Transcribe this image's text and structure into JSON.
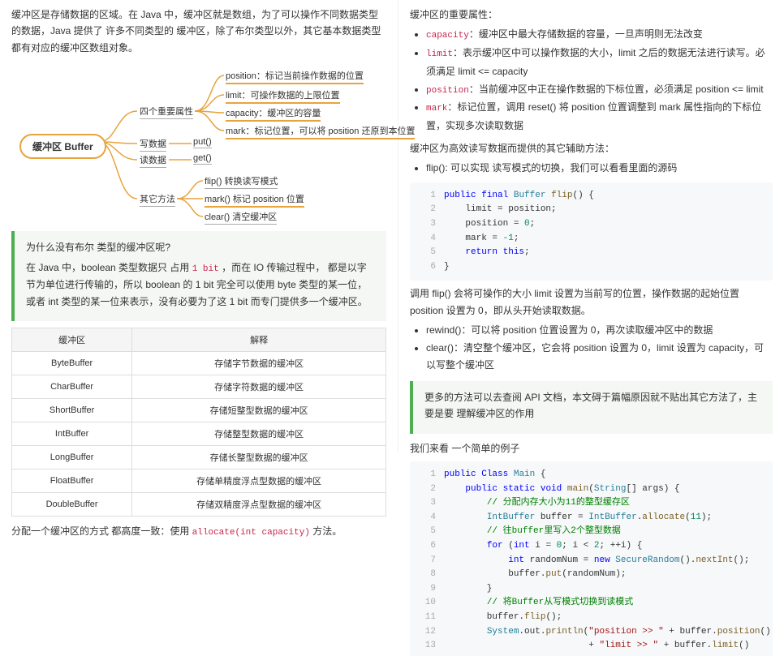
{
  "left": {
    "intro": "缓冲区是存储数据的区域。在 Java 中，缓冲区就是数组，为了可以操作不同数据类型的数据，Java 提供了 许多不同类型的 缓冲区，除了布尔类型以外，其它基本数据类型都有对应的缓冲区数组对象。",
    "mindmap": {
      "root": "缓冲区 Buffer",
      "branch1": "四个重要属性",
      "branch1_leaves": {
        "l1": "position：标记当前操作数据的位置",
        "l2": "limit：可操作数据的上限位置",
        "l3": "capacity：缓冲区的容量",
        "l4": "mark：标记位置，可以将 position 还原到本位置"
      },
      "branch2": "写数据",
      "branch2_leaf": "put()",
      "branch3": "读数据",
      "branch3_leaf": "get()",
      "branch4": "其它方法",
      "branch4_leaves": {
        "l1": "flip() 转换读写模式",
        "l2": "mark() 标记 position 位置",
        "l3": "clear() 清空缓冲区"
      }
    },
    "callout": {
      "q": "为什么没有布尔 类型的缓冲区呢?",
      "a": "在 Java 中，boolean 类型数据只 占用 1 bit ，而在 IO 传输过程中， 都是以字节为单位进行传输的，所以 boolean 的 1 bit 完全可以使用 byte 类型的某一位，或者 int 类型的某一位来表示，没有必要为了这 1 bit 而专门提供多一个缓冲区。"
    },
    "table": {
      "headers": {
        "c1": "缓冲区",
        "c2": "解释"
      },
      "rows": [
        {
          "c1": "ByteBuffer",
          "c2": "存储字节数据的缓冲区"
        },
        {
          "c1": "CharBuffer",
          "c2": "存储字符数据的缓冲区"
        },
        {
          "c1": "ShortBuffer",
          "c2": "存储短整型数据的缓冲区"
        },
        {
          "c1": "IntBuffer",
          "c2": "存储整型数据的缓冲区"
        },
        {
          "c1": "LongBuffer",
          "c2": "存储长整型数据的缓冲区"
        },
        {
          "c1": "FloatBuffer",
          "c2": "存储单精度浮点型数据的缓冲区"
        },
        {
          "c1": "DoubleBuffer",
          "c2": "存储双精度浮点型数据的缓冲区"
        }
      ]
    },
    "bottom1": "分配一个缓冲区的方式 都高度一致：使用 ",
    "bottom_code": "allocate(int capacity)",
    "bottom2": " 方法。"
  },
  "right": {
    "p1": "缓冲区的重要属性：",
    "attrs": {
      "capacity": "：缓冲区中最大存储数据的容量，一旦声明则无法改变",
      "limit": "：表示缓冲区中可以操作数据的大小，limit 之后的数据无法进行读写。必须满足 limit <= capacity",
      "position": "：当前缓冲区中正在操作数据的下标位置，必须满足 position <= limit",
      "mark": "：标记位置，调用 reset() 将 position 位置调整到 mark 属性指向的下标位置，实现多次读取数据"
    },
    "p2": "缓冲区为高效读写数据而提供的其它辅助方法：",
    "helper1": "flip(): 可以实现 读写模式的切换，我们可以看看里面的源码",
    "code1": {
      "l1": "public final Buffer flip() {",
      "l2": "    limit = position;",
      "l3": "    position = 0;",
      "l4": "    mark = -1;",
      "l5": "    return this;",
      "l6": "}"
    },
    "p3": "调用 flip() 会将可操作的大小 limit 设置为当前写的位置，操作数据的起始位置 position 设置为 0，即从头开始读取数据。",
    "helper2": "rewind()：可以将 position 位置设置为 0，再次读取缓冲区中的数据",
    "helper3": "clear()：清空整个缓冲区，它会将 position 设置为 0，limit 设置为 capacity，可以写整个缓冲区",
    "callout2": "更多的方法可以去查阅 API 文档，本文碍于篇幅原因就不贴出其它方法了，主要是要 理解缓冲区的作用",
    "p4": "我们来看 一个简单的例子",
    "code2": {
      "l1": "public Class Main {",
      "l2": "    public static void main(String[] args) {",
      "l3": "        // 分配内存大小为11的整型缓存区",
      "l4": "        IntBuffer buffer = IntBuffer.allocate(11);",
      "l5": "        // 往buffer里写入2个整型数据",
      "l6": "        for (int i = 0; i < 2; ++i) {",
      "l7": "            int randomNum = new SecureRandom().nextInt();",
      "l8": "            buffer.put(randomNum);",
      "l9": "        }",
      "l10": "        // 将Buffer从写模式切换到读模式",
      "l11": "        buffer.flip();",
      "l12": "        System.out.println(\"position >> \" + buffer.position()",
      "l13": "                           + \"limit >> \" + buffer.limit()"
    }
  }
}
